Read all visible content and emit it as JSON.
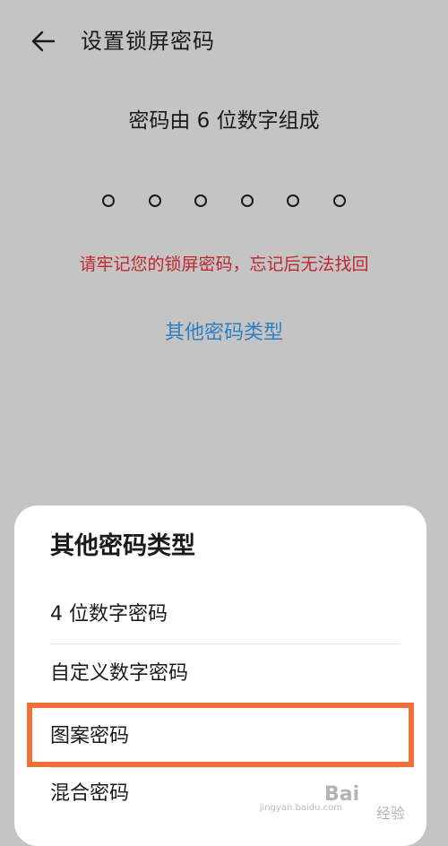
{
  "header": {
    "title": "设置锁屏密码",
    "back_icon": "arrow-left-icon"
  },
  "main": {
    "subtitle": "密码由 6 位数字组成",
    "pin_length": 6,
    "pin_entered": 0,
    "warning": "请牢记您的锁屏密码，忘记后无法找回",
    "other_types_link": "其他密码类型"
  },
  "sheet": {
    "title": "其他密码类型",
    "options": [
      {
        "label": "4 位数字密码"
      },
      {
        "label": "自定义数字密码"
      },
      {
        "label": "图案密码"
      },
      {
        "label": "混合密码"
      }
    ]
  },
  "watermark": {
    "text": "Bai",
    "text_suffix": "经验",
    "url": "jingyan.baidu.com"
  },
  "colors": {
    "background": "#c4c4c4",
    "sheet": "#ffffff",
    "warning": "#c0272d",
    "link": "#2f7fc1",
    "highlight": "#f0703a"
  }
}
